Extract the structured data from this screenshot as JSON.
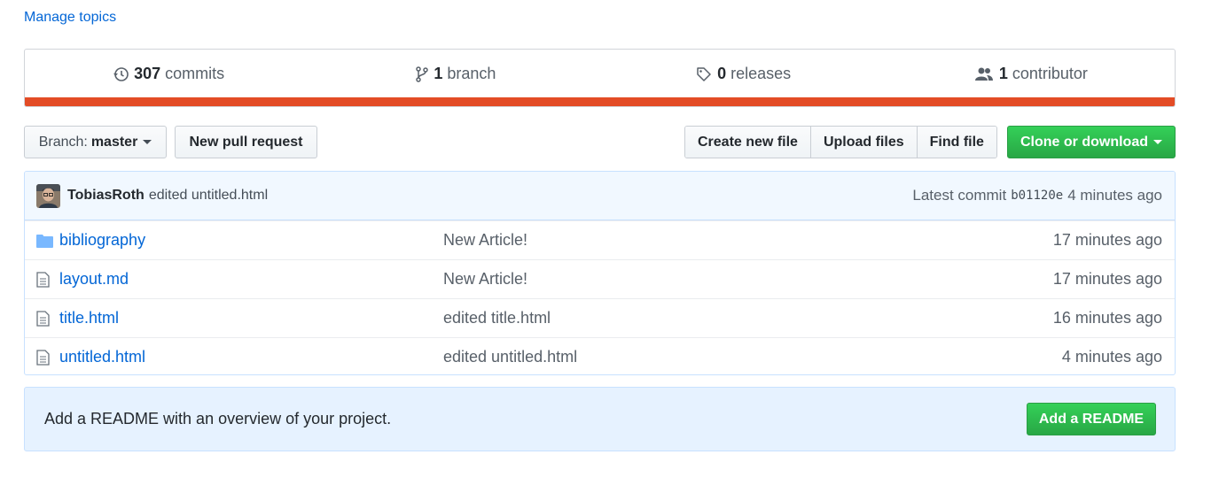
{
  "topics": {
    "manage_label": "Manage topics"
  },
  "summary": {
    "commits": {
      "count": "307",
      "label": "commits"
    },
    "branches": {
      "count": "1",
      "label": "branch"
    },
    "releases": {
      "count": "0",
      "label": "releases"
    },
    "contributors": {
      "count": "1",
      "label": "contributor"
    }
  },
  "language_bar_color": "#e34c26",
  "toolbar": {
    "branch_prefix": "Branch:",
    "branch_name": "master",
    "new_pr_label": "New pull request",
    "create_file_label": "Create new file",
    "upload_files_label": "Upload files",
    "find_file_label": "Find file",
    "clone_label": "Clone or download"
  },
  "latest_commit": {
    "author": "TobiasRoth",
    "message": "edited untitled.html",
    "prefix": "Latest commit",
    "sha": "b01120e",
    "age": "4 minutes ago"
  },
  "files": [
    {
      "type": "folder",
      "name": "bibliography",
      "message": "New Article!",
      "age": "17 minutes ago"
    },
    {
      "type": "file",
      "name": "layout.md",
      "message": "New Article!",
      "age": "17 minutes ago"
    },
    {
      "type": "file",
      "name": "title.html",
      "message": "edited title.html",
      "age": "16 minutes ago"
    },
    {
      "type": "file",
      "name": "untitled.html",
      "message": "edited untitled.html",
      "age": "4 minutes ago"
    }
  ],
  "readme_prompt": {
    "text": "Add a README with an overview of your project.",
    "button_label": "Add a README"
  }
}
